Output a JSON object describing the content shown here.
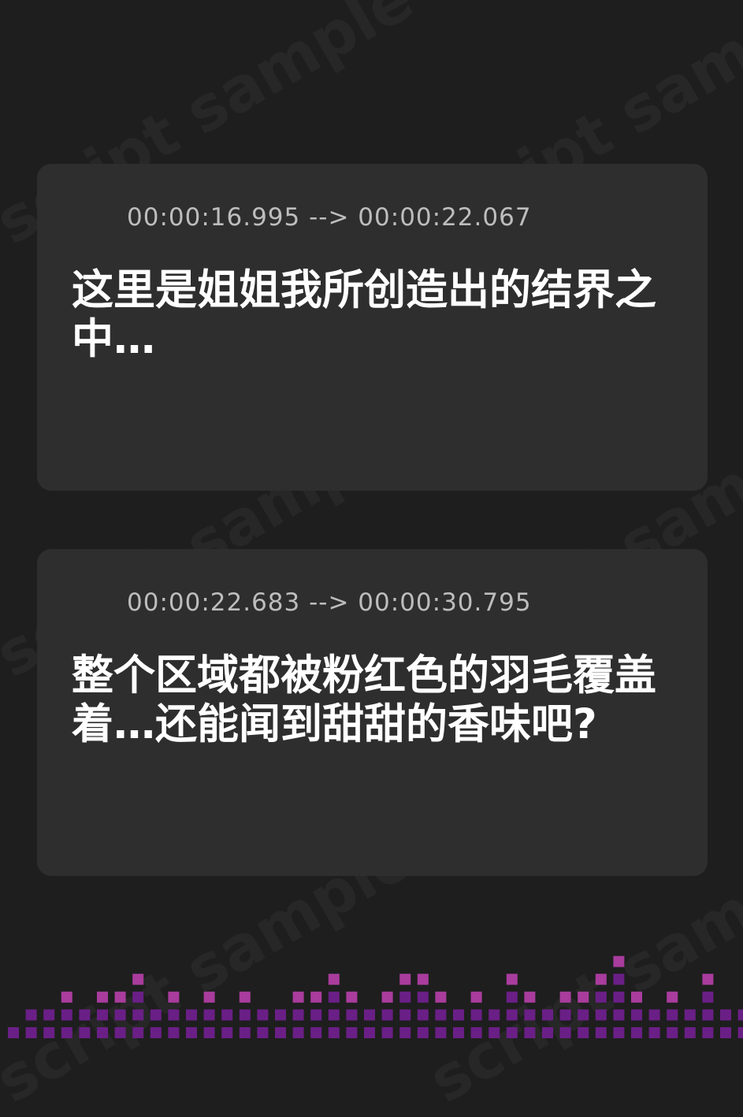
{
  "watermark_text": "script sample",
  "accent_color": "#c040c8",
  "cards": [
    {
      "icon": "sound-wave-icon",
      "timecode": "00:00:16.995 --> 00:00:22.067",
      "text": "这里是姐姐我所创造出的结界之中…"
    },
    {
      "icon": "sound-wave-icon",
      "timecode": "00:00:22.683 --> 00:00:30.795",
      "text": "整个区域都被粉红色的羽毛覆盖着…还能闻到甜甜的香味吧?"
    }
  ],
  "equalizer_colors": {
    "low": "#6a1f86",
    "high": "#a93c9d"
  }
}
